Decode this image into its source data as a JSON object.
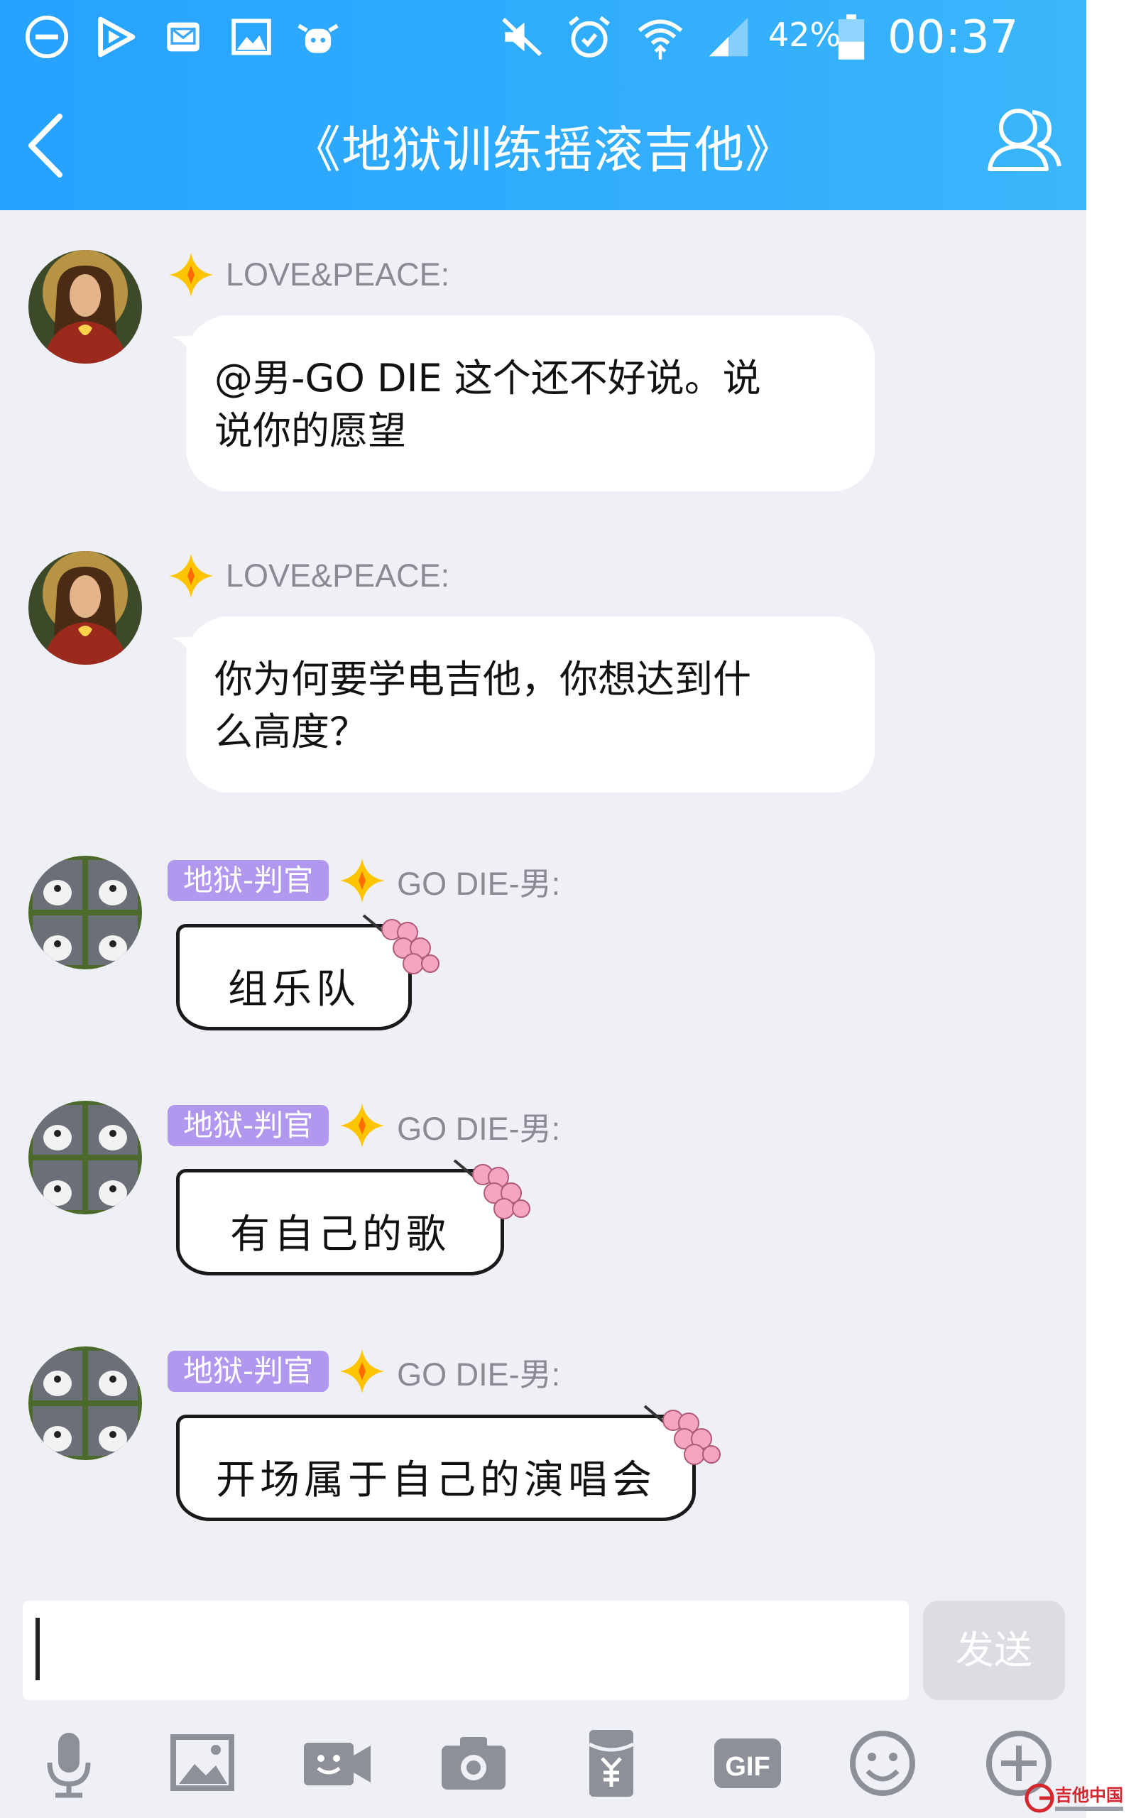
{
  "status_bar": {
    "battery_percent": "42%",
    "time": "00:37",
    "icons": [
      "dnd-icon",
      "video-app-icon",
      "mail-icon",
      "gallery-icon",
      "cow-app-icon",
      "mute-icon",
      "alarm-icon",
      "wifi-icon",
      "signal-icon",
      "battery-icon"
    ]
  },
  "header": {
    "title": "《地狱训练摇滚吉他》",
    "back_icon": "back-arrow-icon",
    "members_icon": "members-icon"
  },
  "messages": [
    {
      "sender": "LOVE&PEACE:",
      "badge": "",
      "text_line1": "@男-GO DIE 这个还不好说。说",
      "text_line2": "说你的愿望",
      "style": "plain"
    },
    {
      "sender": "LOVE&PEACE:",
      "badge": "",
      "text_line1": "你为何要学电吉他，你想达到什",
      "text_line2": "么高度？",
      "style": "plain"
    },
    {
      "sender": "GO DIE-男:",
      "badge": "地狱-判官",
      "text": "组乐队",
      "style": "handwritten"
    },
    {
      "sender": "GO DIE-男:",
      "badge": "地狱-判官",
      "text": "有自己的歌",
      "style": "handwritten"
    },
    {
      "sender": "GO DIE-男:",
      "badge": "地狱-判官",
      "text": "开场属于自己的演唱会",
      "style": "handwritten"
    }
  ],
  "input": {
    "value": "",
    "send_label": "发送"
  },
  "toolbar": {
    "icons": [
      "microphone-icon",
      "image-icon",
      "video-call-icon",
      "camera-icon",
      "red-packet-icon",
      "gif-icon",
      "emoji-icon",
      "plus-icon"
    ],
    "gif_label": "GIF"
  },
  "watermark": {
    "text": "吉他中国"
  },
  "colors": {
    "header_start": "#26a2ff",
    "header_end": "#3ab6fb",
    "background": "#eff0f5",
    "badge": "#b197ee",
    "star": "#ffc400",
    "send_disabled": "#dcdde3"
  }
}
